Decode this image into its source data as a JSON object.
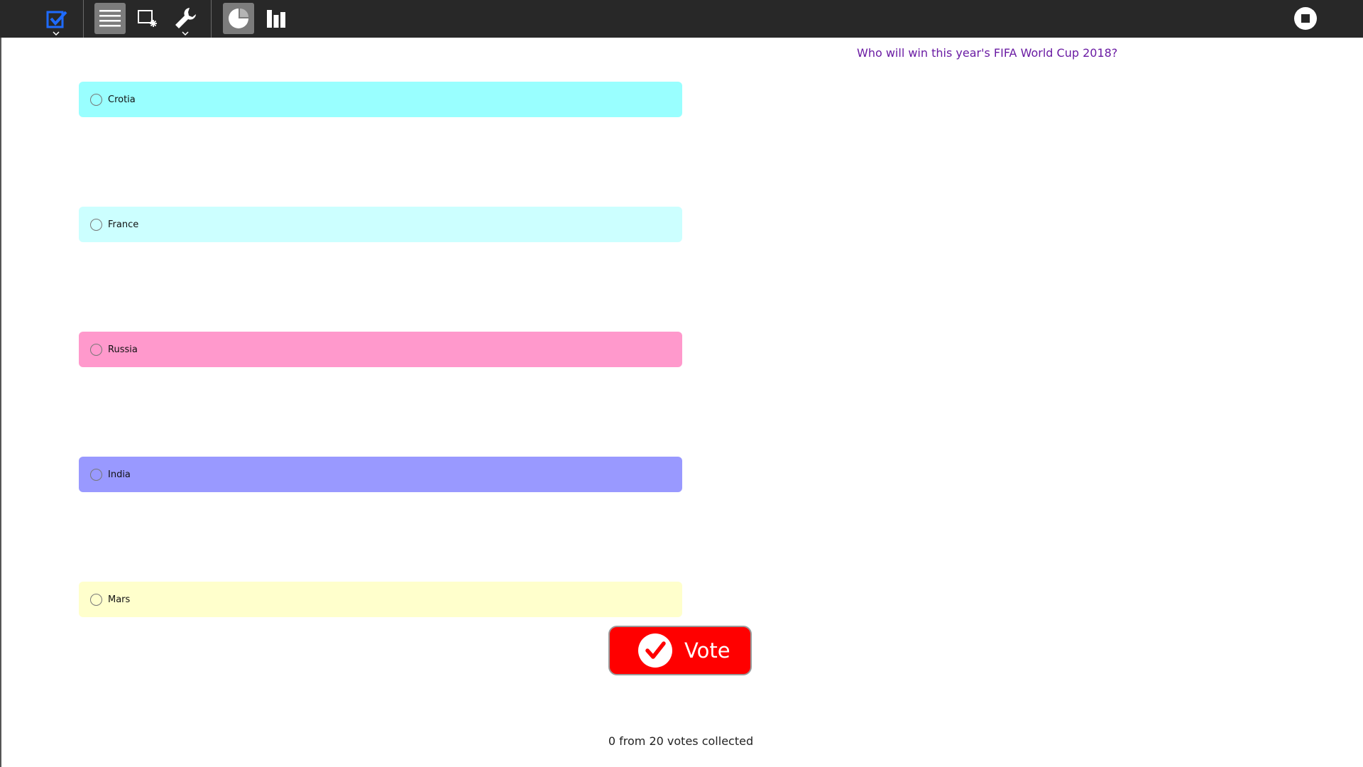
{
  "toolbar": {
    "icons": {
      "poll": "poll-check-icon",
      "list": "list-icon",
      "new_poll": "new-poll-icon",
      "tools": "wrench-icon",
      "pie": "pie-chart-icon",
      "bars": "bar-chart-icon",
      "stop": "stop-icon"
    },
    "colors": {
      "background": "#282828",
      "active": "#7c7c7c",
      "poll_icon": "#1e6bff"
    }
  },
  "poll": {
    "question": "Who will win this year's FIFA World Cup 2018?",
    "options": [
      {
        "label": "Crotia",
        "color": "#99ffff"
      },
      {
        "label": "France",
        "color": "#ccffff"
      },
      {
        "label": "Russia",
        "color": "#ff99cc"
      },
      {
        "label": "India",
        "color": "#9999ff"
      },
      {
        "label": "Mars",
        "color": "#ffffcc"
      }
    ],
    "vote_button": {
      "label": "Vote",
      "color": "#ff0000"
    },
    "votes_status": "0 from 20 votes collected"
  }
}
